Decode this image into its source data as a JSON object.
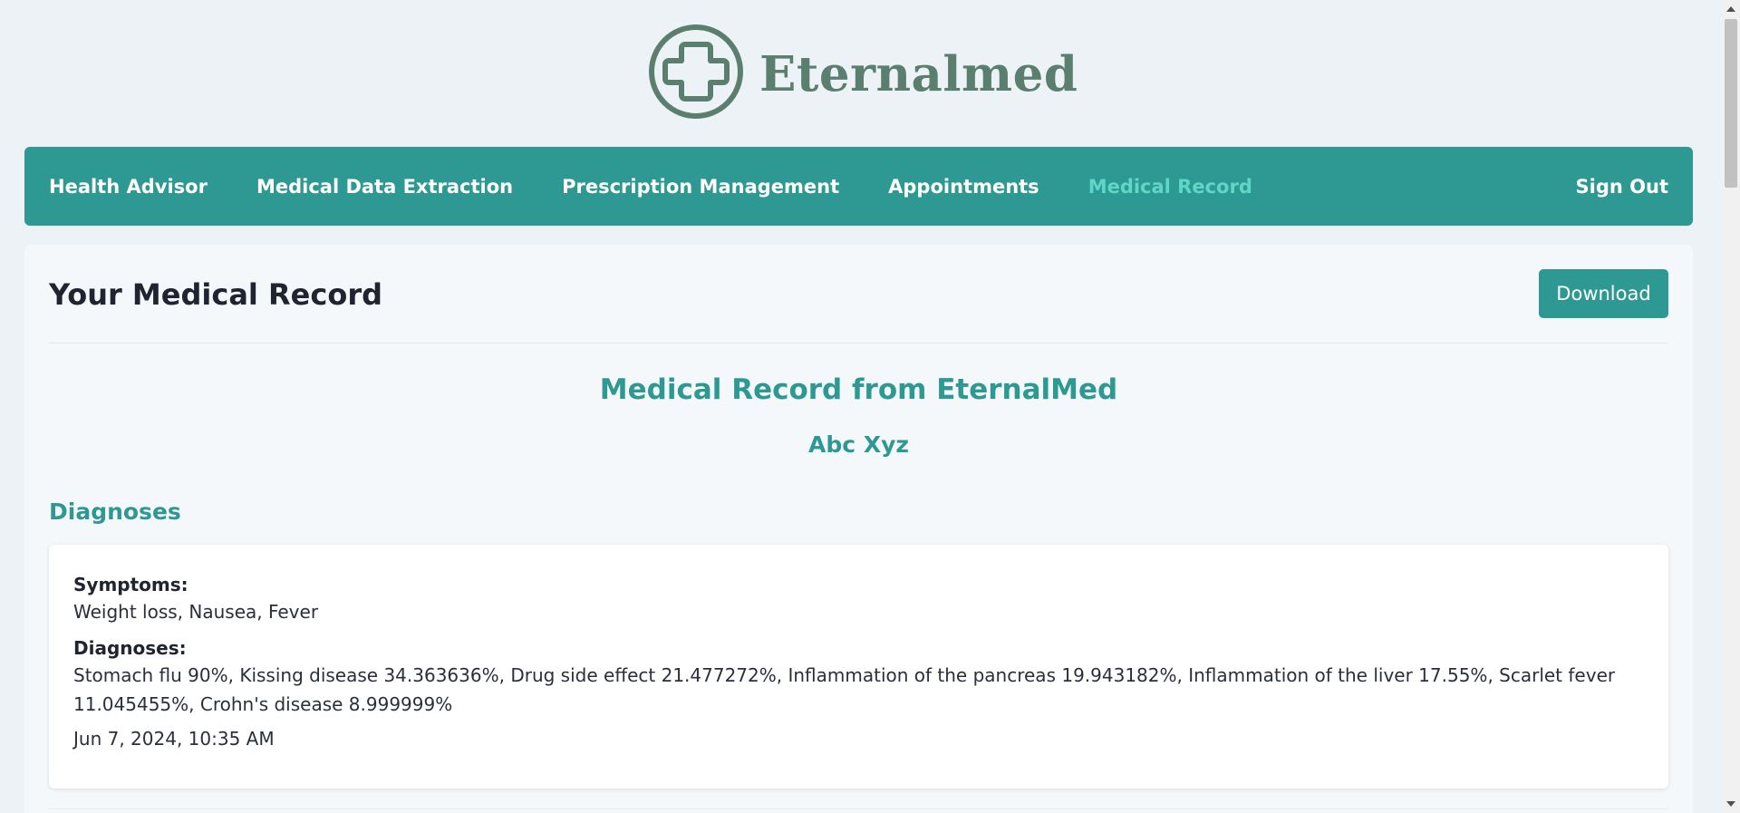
{
  "brand": {
    "name": "Eternalmed",
    "icon": "medical-cross-icon",
    "color": "#5a7f6e"
  },
  "nav": {
    "items": [
      {
        "label": "Health Advisor",
        "active": false
      },
      {
        "label": "Medical Data Extraction",
        "active": false
      },
      {
        "label": "Prescription Management",
        "active": false
      },
      {
        "label": "Appointments",
        "active": false
      },
      {
        "label": "Medical Record",
        "active": true
      }
    ],
    "sign_out": "Sign Out",
    "background": "#2e9893",
    "active_color": "#5fd6c6"
  },
  "main": {
    "title": "Your Medical Record",
    "download_label": "Download",
    "record_title": "Medical Record from EternalMed",
    "patient_name": "Abc Xyz",
    "section_title": "Diagnoses",
    "entry": {
      "symptoms_label": "Symptoms:",
      "symptoms": "Weight loss, Nausea, Fever",
      "diagnoses_label": "Diagnoses:",
      "diagnoses": "Stomach flu 90%, Kissing disease 34.363636%, Drug side effect 21.477272%, Inflammation of the pancreas 19.943182%, Inflammation of the liver 17.55%, Scarlet fever 11.045455%, Crohn's disease 8.999999%",
      "date": "Jun 7, 2024, 10:35 AM"
    }
  }
}
